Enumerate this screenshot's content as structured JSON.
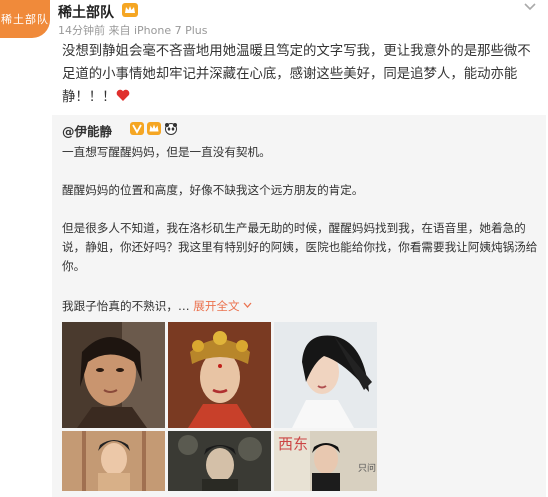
{
  "header": {
    "avatar_text": "稀土部队",
    "user_name": "稀土部队",
    "meta": "14分钟前 来自 iPhone 7 Plus"
  },
  "post": {
    "text": "没想到静姐会毫不吝啬地用她温暖且笃定的文字写我，更让我意外的是那些微不足道的小事情她却牢记并深藏在心底，感谢这些美好，同是追梦人，能动亦能静！！！"
  },
  "repost": {
    "author": "@伊能静",
    "para1": "一直想写醒醒妈妈，但是一直没有契机。",
    "para2": "醒醒妈妈的位置和高度，好像不缺我这个远方朋友的肯定。",
    "para3": "但是很多人不知道，我在洛杉矶生产最无助的时候，醒醒妈妈找到我，在语音里，她着急的说，静姐，你还好吗？我这里有特别好的阿姨，医院也能给你找，你看需要我让阿姨炖锅汤给你。",
    "para4": "我跟子怡真的不熟识，…",
    "expand_label": "展开全文",
    "expand_icon": "chevron-down-icon"
  },
  "thumb_text": {
    "t6a": "西东",
    "t6b": "只问"
  },
  "colors": {
    "accent": "#eb7350",
    "avatar_bg": "#f08a3a",
    "repost_bg": "#f5f5f5",
    "heart": "#e0302d"
  }
}
